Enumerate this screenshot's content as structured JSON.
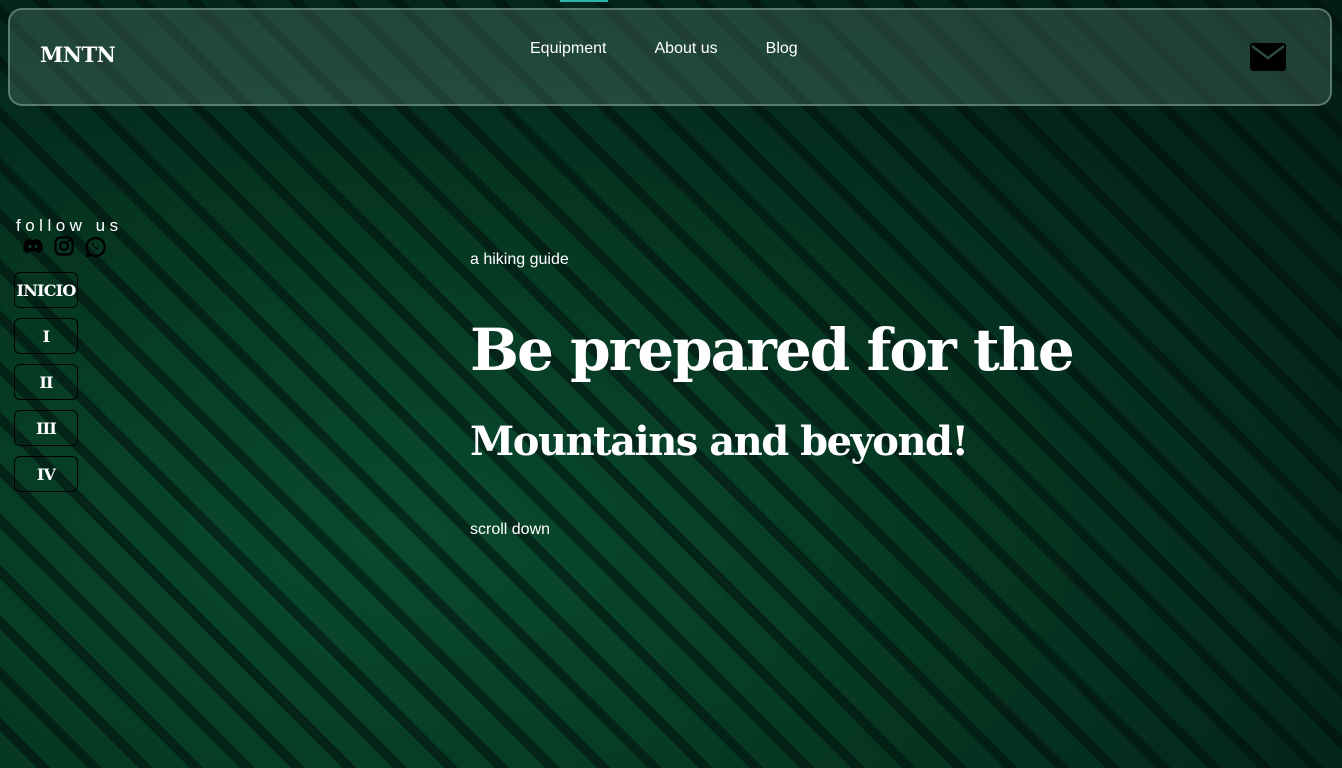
{
  "header": {
    "logo": "MNTN",
    "nav": [
      "Equipment",
      "About us",
      "Blog"
    ],
    "mail_icon": "envelope-icon"
  },
  "sidebar": {
    "follow_label": "follow us",
    "socials": [
      "discord-icon",
      "instagram-icon",
      "whatsapp-icon"
    ],
    "sections": [
      "INICIO",
      "I",
      "II",
      "III",
      "IV"
    ]
  },
  "hero": {
    "eyebrow": "a hiking guide",
    "headline": "Be prepared for the",
    "subhead": "Mountains and beyond!",
    "scroll": "scroll down"
  },
  "colors": {
    "background": "#06301f",
    "accent": "#2bb5a8",
    "text": "#ffffff"
  }
}
